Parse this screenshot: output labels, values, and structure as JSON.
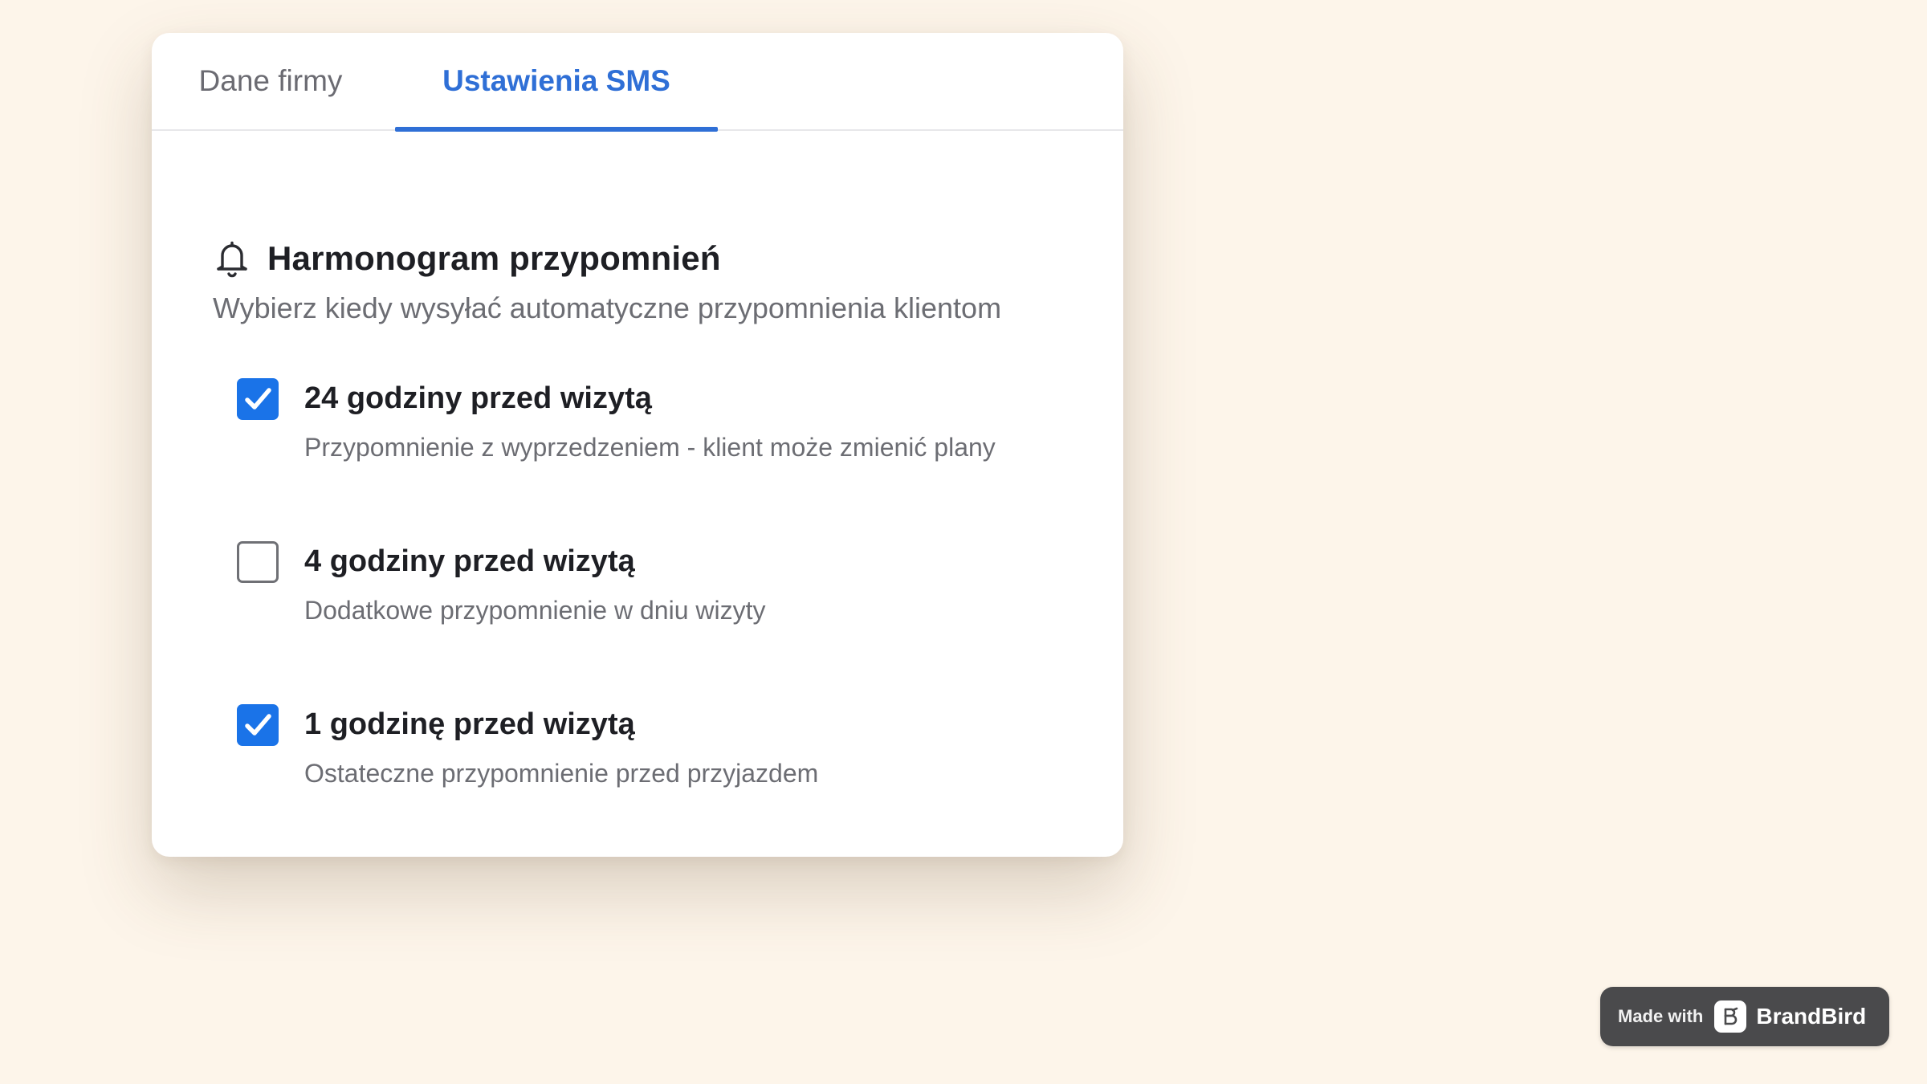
{
  "tabs": {
    "company_label": "Dane firmy",
    "sms_label": "Ustawienia SMS",
    "active": "Ustawienia SMS"
  },
  "section": {
    "icon": "bell-icon",
    "title": "Harmonogram przypomnień",
    "subtitle": "Wybierz kiedy wysyłać automatyczne przypomnienia klientom"
  },
  "reminders": [
    {
      "label": "24 godziny przed wizytą",
      "description": "Przypomnienie z wyprzedzeniem - klient może zmienić plany",
      "checked": true
    },
    {
      "label": "4 godziny przed wizytą",
      "description": "Dodatkowe przypomnienie w dniu wizyty",
      "checked": false
    },
    {
      "label": "1 godzinę przed wizytą",
      "description": "Ostateczne przypomnienie przed przyjazdem",
      "checked": true
    }
  ],
  "badge": {
    "made_with": "Made with",
    "brand": "BrandBird"
  },
  "colors": {
    "accent": "#2f6fd6",
    "checkbox": "#1a73e8",
    "background": "#fdf5ea",
    "badge": "#4a4a4c"
  }
}
